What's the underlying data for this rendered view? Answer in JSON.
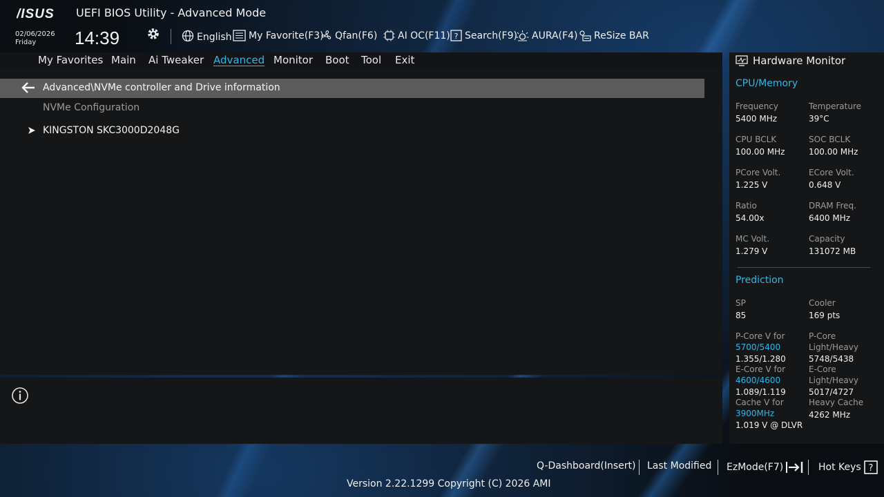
{
  "header": {
    "brand": "ASUS",
    "title": "UEFI BIOS Utility - Advanced Mode",
    "date": "02/06/2026",
    "day": "Friday",
    "time": "14:39",
    "tools": [
      {
        "icon": "globe-icon",
        "label": "English"
      },
      {
        "icon": "favorite-list-icon",
        "label": "My Favorite(F3)"
      },
      {
        "icon": "fan-icon",
        "label": "Qfan(F6)"
      },
      {
        "icon": "ai-chip-icon",
        "label": "AI OC(F11)"
      },
      {
        "icon": "question-box-icon",
        "label": "Search(F9)"
      },
      {
        "icon": "aura-light-icon",
        "label": "AURA(F4)"
      },
      {
        "icon": "resize-bar-icon",
        "label": "ReSize BAR"
      }
    ]
  },
  "nav": {
    "tabs": [
      "My Favorites",
      "Main",
      "Ai Tweaker",
      "Advanced",
      "Monitor",
      "Boot",
      "Tool",
      "Exit"
    ],
    "active": "Advanced"
  },
  "main": {
    "path": "Advanced\\NVMe controller and Drive information",
    "section": "NVMe Configuration",
    "drive": "KINGSTON SKC3000D2048G"
  },
  "hw_monitor": {
    "title": "Hardware Monitor",
    "cpu_memory": {
      "heading": "CPU/Memory",
      "frequency_label": "Frequency",
      "frequency": "5400 MHz",
      "temperature_label": "Temperature",
      "temperature": "39°C",
      "cpu_bclk_label": "CPU BCLK",
      "cpu_bclk": "100.00 MHz",
      "soc_bclk_label": "SOC BCLK",
      "soc_bclk": "100.00 MHz",
      "pcore_volt_label": "PCore Volt.",
      "pcore_volt": "1.225 V",
      "ecore_volt_label": "ECore Volt.",
      "ecore_volt": "0.648 V",
      "ratio_label": "Ratio",
      "ratio": "54.00x",
      "dram_freq_label": "DRAM Freq.",
      "dram_freq": "6400 MHz",
      "mc_volt_label": "MC Volt.",
      "mc_volt": "1.279 V",
      "capacity_label": "Capacity",
      "capacity": "131072 MB"
    },
    "prediction": {
      "heading": "Prediction",
      "sp_label": "SP",
      "sp": "85",
      "cooler_label": "Cooler",
      "cooler": "169 pts",
      "pcore_v_label": "P-Core V for",
      "pcore_v_freq": "5700/5400",
      "pcore_v": "1.355/1.280",
      "pcore_lh_label1": "P-Core",
      "pcore_lh_label2": "Light/Heavy",
      "pcore_lh": "5748/5438",
      "ecore_v_label": "E-Core V for",
      "ecore_v_freq": "4600/4600",
      "ecore_v": "1.089/1.119",
      "ecore_lh_label1": "E-Core",
      "ecore_lh_label2": "Light/Heavy",
      "ecore_lh": "5017/4727",
      "cache_v_label": "Cache V for",
      "cache_v_freq": "3900MHz",
      "cache_v": "1.019 V @ DLVR",
      "heavy_cache_label": "Heavy Cache",
      "heavy_cache": "4262 MHz"
    }
  },
  "footer": {
    "q_dashboard": "Q-Dashboard(Insert)",
    "last_modified": "Last Modified",
    "ezmode": "EzMode(F7)",
    "hotkeys": "Hot Keys",
    "version": "Version 2.22.1299 Copyright (C) 2026 AMI"
  }
}
